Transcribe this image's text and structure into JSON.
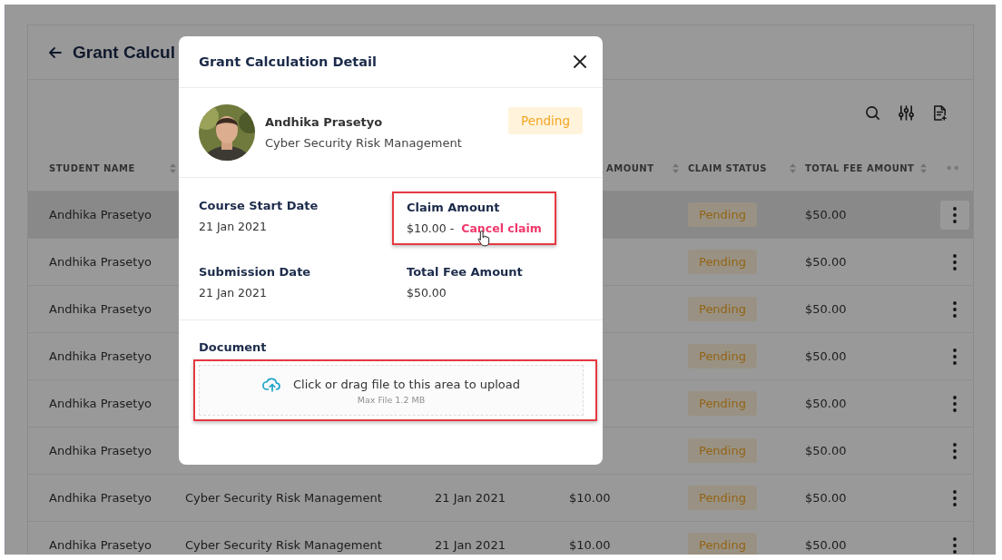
{
  "page": {
    "title": "Grant Calcul"
  },
  "table": {
    "columns": [
      {
        "label": "STUDENT NAME"
      },
      {
        "label": "AMOUNT"
      },
      {
        "label": "CLAIM STATUS"
      },
      {
        "label": "TOTAL FEE AMOUNT"
      }
    ],
    "rows": [
      {
        "student_name": "Andhika Prasetyo",
        "claim_status": "Pending",
        "total_fee": "$50.00",
        "selected": true
      },
      {
        "student_name": "Andhika Prasetyo",
        "claim_status": "Pending",
        "total_fee": "$50.00",
        "selected": false
      },
      {
        "student_name": "Andhika Prasetyo",
        "claim_status": "Pending",
        "total_fee": "$50.00",
        "selected": false
      },
      {
        "student_name": "Andhika Prasetyo",
        "claim_status": "Pending",
        "total_fee": "$50.00",
        "selected": false
      },
      {
        "student_name": "Andhika Prasetyo",
        "claim_status": "Pending",
        "total_fee": "$50.00",
        "selected": false
      },
      {
        "student_name": "Andhika Prasetyo",
        "claim_status": "Pending",
        "total_fee": "$50.00",
        "selected": false
      },
      {
        "student_name": "Andhika Prasetyo",
        "course": "Cyber Security Risk Management",
        "start_date": "21 Jan 2021",
        "claim_amount": "$10.00",
        "claim_status": "Pending",
        "total_fee": "$50.00",
        "selected": false
      },
      {
        "student_name": "Andhika Prasetyo",
        "course": "Cyber Security Risk Management",
        "start_date": "21 Jan 2021",
        "claim_amount": "$10.00",
        "claim_status": "Pending",
        "total_fee": "$50.00",
        "selected": false
      }
    ]
  },
  "modal": {
    "title": "Grant Calculation Detail",
    "profile": {
      "name": "Andhika Prasetyo",
      "course": "Cyber Security Risk Management",
      "status": "Pending"
    },
    "fields": [
      {
        "label": "Course Start Date",
        "value": "21 Jan 2021",
        "highlighted": false
      },
      {
        "label": "Claim Amount",
        "value": "$10.00 -",
        "link": "Cancel claim",
        "highlighted": true
      },
      {
        "label": "Submission Date",
        "value": "21 Jan 2021",
        "highlighted": false
      },
      {
        "label": "Total Fee Amount",
        "value": "$50.00",
        "highlighted": false
      }
    ],
    "document": {
      "label": "Document",
      "upload_text": "Click or drag file to this area to upload",
      "hint": "Max File 1.2 MB",
      "highlighted": true
    }
  }
}
